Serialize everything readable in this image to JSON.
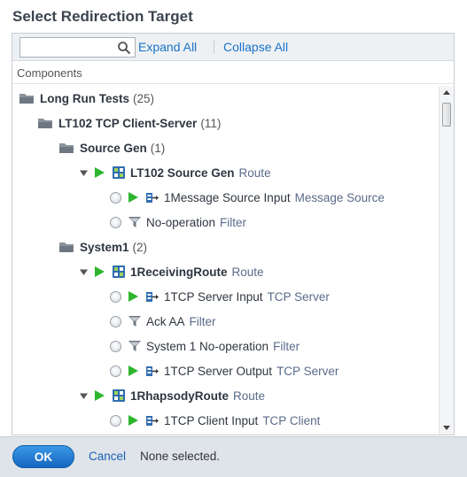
{
  "dialog": {
    "title": "Select Redirection Target"
  },
  "toolbar": {
    "search_value": "",
    "search_placeholder": "",
    "expand_all": "Expand All",
    "collapse_all": "Collapse All"
  },
  "column_header": "Components",
  "tree": [
    {
      "kind": "folder",
      "name": "Long Run Tests",
      "count": "(25)",
      "bold": true,
      "level": 0
    },
    {
      "kind": "folder",
      "name": "LT102 TCP Client-Server",
      "count": "(11)",
      "bold": true,
      "level": 1
    },
    {
      "kind": "folder",
      "name": "Source Gen",
      "count": "(1)",
      "bold": true,
      "level": 2
    },
    {
      "kind": "route",
      "name": "LT102 Source Gen",
      "type": "Route",
      "bold": true,
      "level": 3
    },
    {
      "kind": "component",
      "name": "1Message Source Input",
      "type": "Message Source",
      "level": 4,
      "play": true
    },
    {
      "kind": "filter",
      "name": "No-operation",
      "type": "Filter",
      "level": 4
    },
    {
      "kind": "folder",
      "name": "System1",
      "count": "(2)",
      "bold": true,
      "level": 2
    },
    {
      "kind": "route",
      "name": "1ReceivingRoute",
      "type": "Route",
      "bold": true,
      "level": 3
    },
    {
      "kind": "component",
      "name": "1TCP Server Input",
      "type": "TCP Server",
      "level": 4,
      "play": true
    },
    {
      "kind": "filter",
      "name": "Ack AA",
      "type": "Filter",
      "level": 4
    },
    {
      "kind": "filter",
      "name": "System 1 No-operation",
      "type": "Filter",
      "level": 4
    },
    {
      "kind": "component",
      "name": "1TCP Server Output",
      "type": "TCP Server",
      "level": 4,
      "play": true
    },
    {
      "kind": "route",
      "name": "1RhapsodyRoute",
      "type": "Route",
      "bold": true,
      "level": 3
    },
    {
      "kind": "component",
      "name": "1TCP Client Input",
      "type": "TCP Client",
      "level": 4,
      "play": true
    }
  ],
  "footer": {
    "ok_label": "OK",
    "cancel_label": "Cancel",
    "status_text": "None selected."
  },
  "colors": {
    "accent": "#1a73c8",
    "play_green": "#2db52d",
    "ok_blue": "#1f7bd6"
  },
  "icons": {
    "search": "search-icon",
    "folder": "folder-icon",
    "route": "route-icon",
    "component": "component-icon",
    "filter": "filter-icon",
    "play": "play-icon",
    "expand": "chevron-down-icon"
  }
}
